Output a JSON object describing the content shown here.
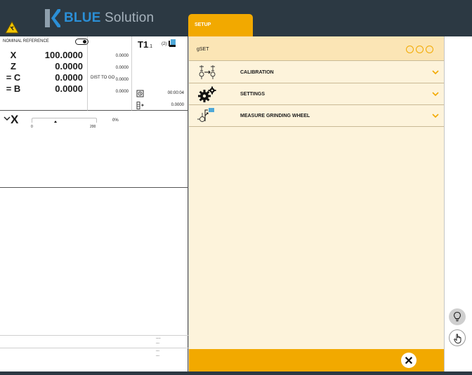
{
  "header": {
    "brand_strong": "BLUE",
    "brand_light": "Solution",
    "tab_label": "SETUP"
  },
  "position": {
    "nominal_label": "NOMINAL REFERENCE",
    "dist_label": "DIST TO GO",
    "axes": [
      {
        "name": "X",
        "value": "100.0000",
        "dist": "0.0000"
      },
      {
        "name": "Z",
        "value": "0.0000",
        "dist": "0.0000"
      },
      {
        "name": "= C",
        "value": "0.0000",
        "dist": "0.0000"
      },
      {
        "name": "= B",
        "value": "0.0000",
        "dist": "0.0000"
      }
    ]
  },
  "tool": {
    "id": "T1",
    "sub": ".1",
    "qty": "(2)",
    "time": "00:00:04",
    "value": "0.0000"
  },
  "feed": {
    "axis": "X",
    "min": "0",
    "max": "200",
    "percent": "0%",
    "level_fraction": 0.37
  },
  "program_rows": [
    "----",
    "---",
    "---",
    "---"
  ],
  "setup": {
    "gset_label": "gSET",
    "items": [
      {
        "label": "CALIBRATION"
      },
      {
        "label": "SETTINGS"
      },
      {
        "label": "MEASURE GRINDING WHEEL"
      }
    ]
  },
  "colors": {
    "accent": "#f2a900",
    "header_bg": "#2c3943",
    "panel_bg": "#fdf3db",
    "brand_blue": "#2b8fd6"
  }
}
